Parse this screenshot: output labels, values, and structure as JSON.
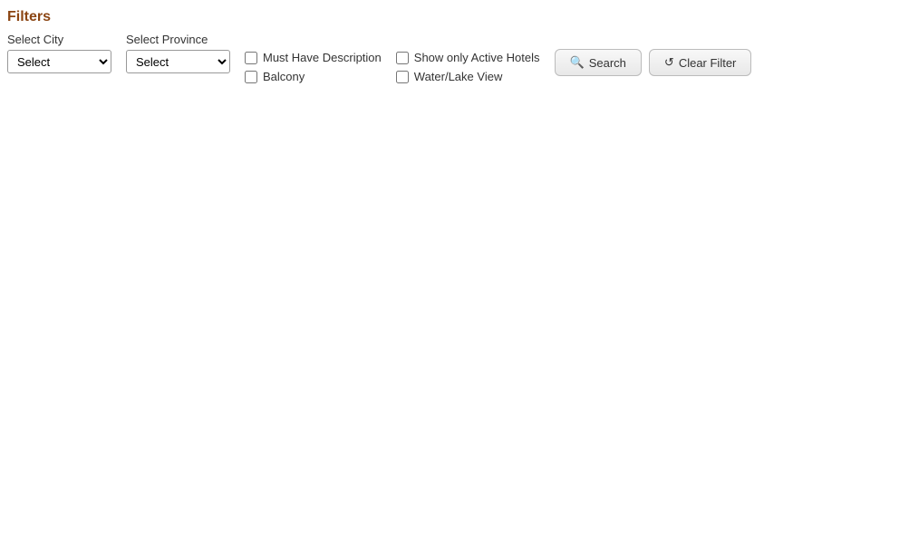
{
  "page": {
    "title": "Filters"
  },
  "filters": {
    "city": {
      "label": "Select City",
      "default_option": "Select",
      "options": [
        "Select"
      ]
    },
    "province": {
      "label": "Select Province",
      "default_option": "Select",
      "options": [
        "Select"
      ]
    },
    "checkboxes": [
      {
        "id": "must-have-desc",
        "label": "Must Have Description",
        "checked": false
      },
      {
        "id": "balcony",
        "label": "Balcony",
        "checked": false
      },
      {
        "id": "show-active",
        "label": "Show only Active Hotels",
        "checked": false
      },
      {
        "id": "water-lake-view",
        "label": "Water/Lake View",
        "checked": false
      }
    ],
    "buttons": {
      "search": {
        "label": "Search",
        "icon": "🔍"
      },
      "clear": {
        "label": "Clear Filter",
        "icon": "↺"
      }
    }
  }
}
